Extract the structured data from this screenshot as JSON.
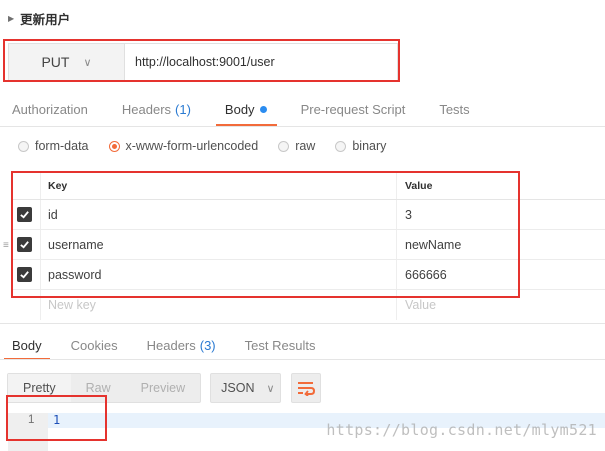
{
  "request": {
    "title": "更新用户",
    "method": "PUT",
    "url": "http://localhost:9001/user"
  },
  "request_tabs": [
    {
      "label": "Authorization",
      "count": ""
    },
    {
      "label": "Headers",
      "count": "(1)"
    },
    {
      "label": "Body",
      "count": ""
    },
    {
      "label": "Pre-request Script",
      "count": ""
    },
    {
      "label": "Tests",
      "count": ""
    }
  ],
  "body_modes": [
    "form-data",
    "x-www-form-urlencoded",
    "raw",
    "binary"
  ],
  "body_mode_selected": "x-www-form-urlencoded",
  "table": {
    "key_header": "Key",
    "value_header": "Value",
    "rows": [
      {
        "key": "id",
        "value": "3",
        "checked": true
      },
      {
        "key": "username",
        "value": "newName",
        "checked": true
      },
      {
        "key": "password",
        "value": "666666",
        "checked": true
      }
    ],
    "key_placeholder": "New key",
    "value_placeholder": "Value"
  },
  "response_tabs": [
    {
      "label": "Body",
      "count": ""
    },
    {
      "label": "Cookies",
      "count": ""
    },
    {
      "label": "Headers",
      "count": "(3)"
    },
    {
      "label": "Test Results",
      "count": ""
    }
  ],
  "response_view": {
    "pretty": "Pretty",
    "raw": "Raw",
    "preview": "Preview",
    "format": "JSON"
  },
  "response_body": {
    "line_number": "1",
    "content": "1"
  },
  "watermark": "https://blog.csdn.net/mlym521",
  "colors": {
    "accent": "#f26b3a",
    "highlight_box": "#e5332e",
    "count": "#2a7ad2"
  }
}
